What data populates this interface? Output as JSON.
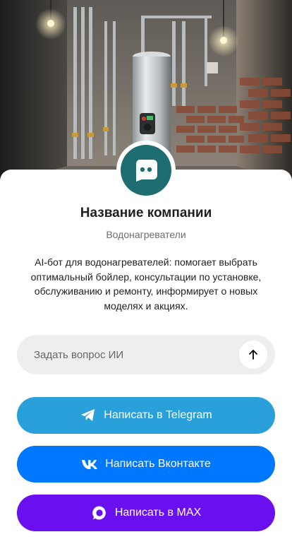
{
  "hero": {
    "image_description": "boiler-room-photo",
    "icon": "water-heater-illustration"
  },
  "profile": {
    "avatar_icon": "chat-bot-icon",
    "company_name": "Название компании",
    "category": "Водонагреватели",
    "description": "AI-бот для водонагревателей: помогает выбрать оптимальный бойлер, консультации по установке, обслуживанию и ремонту, информирует о новых моделях и акциях."
  },
  "ask": {
    "placeholder": "Задать вопрос ИИ",
    "value": "",
    "send_icon": "arrow-up-icon"
  },
  "buttons": {
    "telegram": {
      "label": "Написать в Telegram",
      "icon": "telegram-icon",
      "color": "#2aa0da"
    },
    "vk": {
      "label": "Написать Вконтакте",
      "icon": "vk-icon",
      "color": "#0077ff"
    },
    "max": {
      "label": "Написать в MAX",
      "icon": "max-icon",
      "color": "#6a0ff0"
    }
  },
  "colors": {
    "accent": "#1e6e71"
  }
}
